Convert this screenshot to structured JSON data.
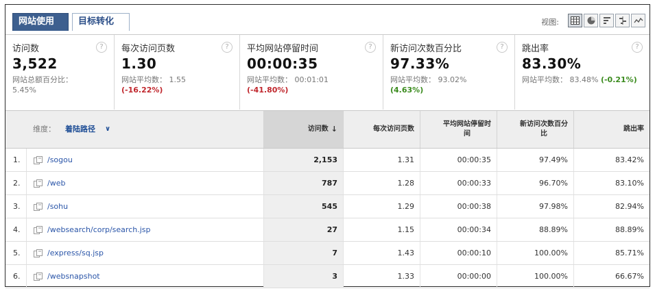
{
  "tabs": [
    {
      "label": "网站使用",
      "active": true
    },
    {
      "label": "目标转化",
      "active": false
    }
  ],
  "view_label": "视图:",
  "view_icons": [
    "table-view-icon",
    "pie-view-icon",
    "bar-view-icon",
    "comparison-view-icon",
    "trend-view-icon"
  ],
  "metrics": [
    {
      "label": "访问数",
      "value": "3,522",
      "sub": "网站总额百分比：",
      "sub_value": "5.45%",
      "diff": "",
      "diff_type": ""
    },
    {
      "label": "每次访问页数",
      "value": "1.30",
      "sub": "网站平均数： 1.55",
      "sub_value": "",
      "diff": "(-16.22%)",
      "diff_type": "neg"
    },
    {
      "label": "平均网站停留时间",
      "value": "00:00:35",
      "sub": "网站平均数： 00:01:01",
      "sub_value": "",
      "diff": "(-41.80%)",
      "diff_type": "neg"
    },
    {
      "label": "新访问次数百分比",
      "value": "97.33%",
      "sub": "网站平均数： 93.02%",
      "sub_value": "",
      "diff": "(4.63%)",
      "diff_type": "pos"
    },
    {
      "label": "跳出率",
      "value": "83.30%",
      "sub": "网站平均数： 83.48%",
      "sub_value": "",
      "diff": "(-0.21%)",
      "diff_type": "pos"
    }
  ],
  "help_glyph": "?",
  "table": {
    "dimension_label": "维度：",
    "dimension_value": "着陆路径",
    "dimension_arrow": "∨",
    "headers": [
      "访问数",
      "每次访问页数",
      "平均网站停留时间",
      "新访问次数百分比",
      "跳出率"
    ],
    "sort_arrow": "↓",
    "rows": [
      {
        "idx": "1.",
        "page": "/sogou",
        "visits": "2,153",
        "ppv": "1.31",
        "time": "00:00:35",
        "new": "97.49%",
        "bounce": "83.42%"
      },
      {
        "idx": "2.",
        "page": "/web",
        "visits": "787",
        "ppv": "1.28",
        "time": "00:00:33",
        "new": "96.70%",
        "bounce": "83.10%"
      },
      {
        "idx": "3.",
        "page": "/sohu",
        "visits": "545",
        "ppv": "1.29",
        "time": "00:00:38",
        "new": "97.98%",
        "bounce": "82.94%"
      },
      {
        "idx": "4.",
        "page": "/websearch/corp/search.jsp",
        "visits": "27",
        "ppv": "1.15",
        "time": "00:00:34",
        "new": "88.89%",
        "bounce": "88.89%"
      },
      {
        "idx": "5.",
        "page": "/express/sq.jsp",
        "visits": "7",
        "ppv": "1.43",
        "time": "00:00:10",
        "new": "100.00%",
        "bounce": "85.71%"
      },
      {
        "idx": "6.",
        "page": "/websnapshot",
        "visits": "3",
        "ppv": "1.33",
        "time": "00:00:00",
        "new": "100.00%",
        "bounce": "66.67%"
      }
    ]
  }
}
